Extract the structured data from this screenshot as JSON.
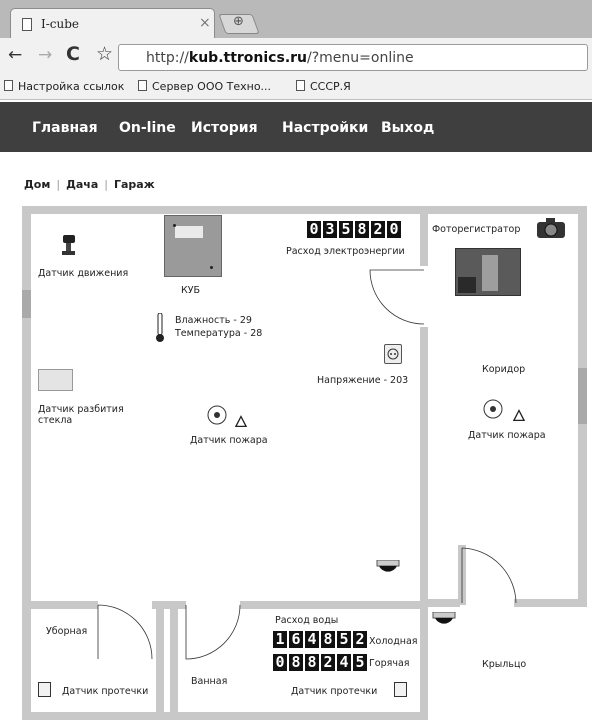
{
  "browser": {
    "tab_title": "I-cube",
    "url_prefix": "http://",
    "url_host": "kub.ttronics.ru",
    "url_path": "/?menu=online",
    "bookmarks": [
      "Настройка ссылок",
      "Сервер ООО Техно...",
      "СССР.Я"
    ]
  },
  "nav": {
    "items": [
      "Главная",
      "On-line",
      "История",
      "Настройки",
      "Выход"
    ]
  },
  "buildings": [
    "Дом",
    "Дача",
    "Гараж"
  ],
  "plan": {
    "motion_sensor": "Датчик движения",
    "kub": "КУБ",
    "humidity": "Влажность - 29",
    "temperature": "Температура - 28",
    "electricity_counter": [
      "0",
      "3",
      "5",
      "8",
      "2",
      "0"
    ],
    "electricity_label": "Расход электроэнергии",
    "voltage": "Напряжение - 203",
    "glass_sensor": "Датчик разбития\nстекла",
    "fire_sensor_main": "Датчик пожара",
    "photo_recorder": "Фоторегистратор",
    "corridor": "Коридор",
    "fire_sensor_corridor": "Датчик пожара",
    "toilet": "Уборная",
    "leak_sensor_toilet": "Датчик протечки",
    "bathroom": "Ванная",
    "water_label": "Расход воды",
    "cold_counter": [
      "1",
      "6",
      "4",
      "8",
      "5",
      "2"
    ],
    "cold_label": "Холодная",
    "hot_counter": [
      "0",
      "8",
      "8",
      "2",
      "4",
      "5"
    ],
    "hot_label": "Горячая",
    "leak_sensor_bath": "Датчик протечки",
    "porch": "Крыльцо"
  }
}
